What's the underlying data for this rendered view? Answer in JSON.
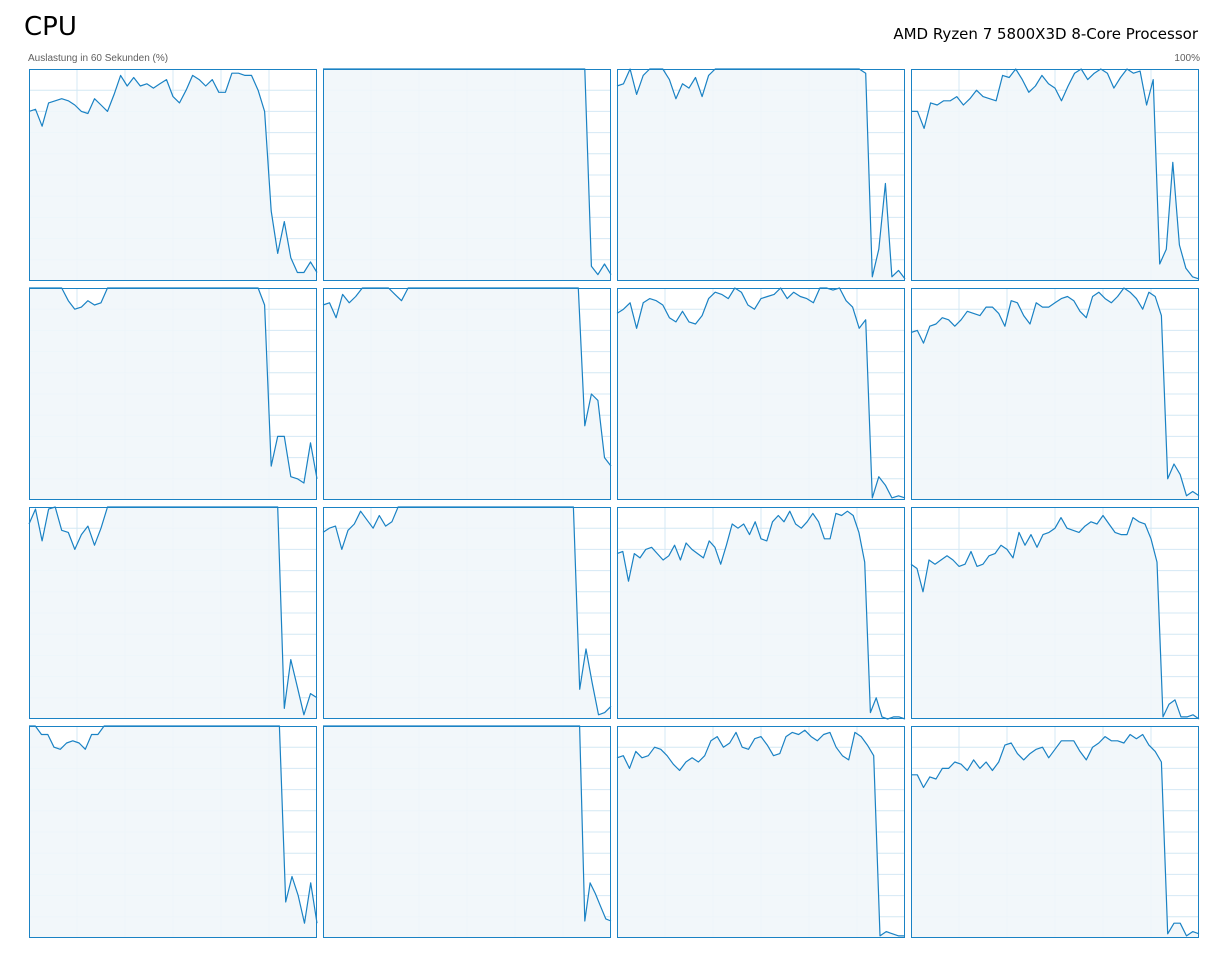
{
  "header": {
    "title": "CPU",
    "processor": "AMD Ryzen 7 5800X3D 8-Core Processor",
    "subtitle": "Auslastung in 60 Sekunden (%)",
    "max_label": "100%"
  },
  "colors": {
    "line": "#1a82c4",
    "fill": "#f1f6fa",
    "grid": "#d4e8f4",
    "border": "#1a82c4"
  },
  "chart_data": {
    "type": "area",
    "layout": "4x4 small multiples, one per logical processor",
    "x_range_seconds": [
      0,
      60
    ],
    "ylim": [
      0,
      100
    ],
    "grid": true,
    "series": [
      {
        "values": [
          80,
          81,
          73,
          84,
          85,
          86,
          85,
          83,
          80,
          79,
          86,
          83,
          80,
          88,
          97,
          92,
          96,
          92,
          93,
          91,
          93,
          95,
          87,
          84,
          90,
          97,
          95,
          92,
          95,
          89,
          89,
          98,
          98,
          97,
          97,
          90,
          80,
          33,
          13,
          28,
          11,
          4,
          4,
          9,
          4
        ]
      },
      {
        "values": [
          100,
          100,
          100,
          100,
          100,
          100,
          100,
          100,
          100,
          100,
          100,
          100,
          100,
          100,
          100,
          100,
          100,
          100,
          100,
          100,
          100,
          100,
          100,
          100,
          100,
          100,
          100,
          100,
          100,
          100,
          100,
          100,
          100,
          100,
          100,
          100,
          100,
          100,
          100,
          100,
          100,
          7,
          3,
          8,
          3
        ]
      },
      {
        "values": [
          92,
          93,
          100,
          88,
          97,
          100,
          100,
          100,
          95,
          86,
          93,
          91,
          96,
          87,
          97,
          100,
          100,
          100,
          100,
          100,
          100,
          100,
          100,
          100,
          100,
          100,
          100,
          100,
          100,
          100,
          100,
          100,
          100,
          100,
          100,
          100,
          100,
          100,
          98,
          2,
          15,
          46,
          2,
          5,
          1
        ]
      },
      {
        "values": [
          80,
          80,
          72,
          84,
          83,
          85,
          85,
          87,
          83,
          86,
          90,
          87,
          86,
          85,
          97,
          96,
          100,
          95,
          89,
          92,
          97,
          93,
          91,
          85,
          92,
          98,
          100,
          95,
          98,
          100,
          98,
          91,
          96,
          100,
          98,
          99,
          83,
          95,
          8,
          15,
          56,
          17,
          6,
          2,
          1
        ]
      },
      {
        "values": [
          100,
          100,
          100,
          100,
          100,
          100,
          94,
          90,
          91,
          94,
          92,
          93,
          100,
          100,
          100,
          100,
          100,
          100,
          100,
          100,
          100,
          100,
          100,
          100,
          100,
          100,
          100,
          100,
          100,
          100,
          100,
          100,
          100,
          100,
          100,
          100,
          92,
          16,
          30,
          30,
          11,
          10,
          8,
          27,
          10
        ]
      },
      {
        "values": [
          92,
          93,
          86,
          97,
          93,
          96,
          100,
          100,
          100,
          100,
          100,
          97,
          94,
          100,
          100,
          100,
          100,
          100,
          100,
          100,
          100,
          100,
          100,
          100,
          100,
          100,
          100,
          100,
          100,
          100,
          100,
          100,
          100,
          100,
          100,
          100,
          100,
          100,
          100,
          100,
          35,
          50,
          47,
          20,
          16
        ]
      },
      {
        "values": [
          88,
          90,
          93,
          81,
          93,
          95,
          94,
          92,
          86,
          84,
          89,
          84,
          83,
          87,
          95,
          98,
          97,
          95,
          100,
          98,
          92,
          90,
          95,
          96,
          97,
          100,
          95,
          98,
          96,
          95,
          93,
          100,
          100,
          99,
          100,
          94,
          91,
          81,
          85,
          1,
          11,
          7,
          1,
          2,
          1
        ]
      },
      {
        "values": [
          79,
          80,
          74,
          82,
          83,
          86,
          85,
          82,
          85,
          89,
          88,
          87,
          91,
          91,
          88,
          82,
          94,
          93,
          87,
          83,
          93,
          91,
          91,
          93,
          95,
          96,
          94,
          89,
          86,
          96,
          98,
          95,
          93,
          96,
          100,
          98,
          95,
          90,
          98,
          96,
          87,
          10,
          17,
          12,
          2,
          4,
          2
        ]
      },
      {
        "values": [
          92,
          99,
          84,
          99,
          100,
          89,
          88,
          80,
          87,
          91,
          82,
          90,
          100,
          100,
          100,
          100,
          100,
          100,
          100,
          100,
          100,
          100,
          100,
          100,
          100,
          100,
          100,
          100,
          100,
          100,
          100,
          100,
          100,
          100,
          100,
          100,
          100,
          100,
          100,
          5,
          28,
          15,
          2,
          12,
          10
        ]
      },
      {
        "values": [
          88,
          90,
          91,
          80,
          89,
          92,
          98,
          94,
          90,
          96,
          91,
          93,
          100,
          100,
          100,
          100,
          100,
          100,
          100,
          100,
          100,
          100,
          100,
          100,
          100,
          100,
          100,
          100,
          100,
          100,
          100,
          100,
          100,
          100,
          100,
          100,
          100,
          100,
          100,
          100,
          100,
          14,
          33,
          17,
          2,
          3,
          6
        ]
      },
      {
        "values": [
          78,
          79,
          65,
          78,
          76,
          80,
          81,
          78,
          75,
          77,
          82,
          75,
          83,
          80,
          78,
          76,
          84,
          81,
          73,
          82,
          92,
          90,
          92,
          87,
          93,
          85,
          84,
          93,
          96,
          93,
          98,
          92,
          90,
          93,
          97,
          93,
          85,
          85,
          97,
          96,
          98,
          96,
          88,
          74,
          3,
          10,
          1,
          0,
          1,
          1,
          0
        ]
      },
      {
        "values": [
          73,
          71,
          60,
          75,
          73,
          75,
          77,
          75,
          72,
          73,
          79,
          72,
          73,
          77,
          78,
          82,
          80,
          76,
          88,
          82,
          87,
          81,
          87,
          88,
          90,
          95,
          90,
          89,
          88,
          91,
          93,
          92,
          96,
          92,
          88,
          87,
          87,
          95,
          93,
          92,
          85,
          74,
          1,
          7,
          9,
          1,
          1,
          2,
          0
        ]
      },
      {
        "values": [
          100,
          100,
          96,
          96,
          90,
          89,
          92,
          93,
          92,
          89,
          96,
          96,
          100,
          100,
          100,
          100,
          100,
          100,
          100,
          100,
          100,
          100,
          100,
          100,
          100,
          100,
          100,
          100,
          100,
          100,
          100,
          100,
          100,
          100,
          100,
          100,
          100,
          100,
          100,
          100,
          100,
          17,
          29,
          20,
          7,
          26,
          7
        ]
      },
      {
        "values": [
          100,
          100,
          100,
          100,
          100,
          100,
          100,
          100,
          100,
          100,
          100,
          100,
          100,
          100,
          100,
          100,
          100,
          100,
          100,
          100,
          100,
          100,
          100,
          100,
          100,
          100,
          100,
          100,
          100,
          100,
          100,
          100,
          100,
          100,
          100,
          100,
          100,
          100,
          100,
          100,
          100,
          100,
          100,
          100,
          100,
          100,
          100,
          100,
          100,
          100,
          8,
          26,
          21,
          15,
          9,
          8
        ]
      },
      {
        "values": [
          85,
          86,
          80,
          88,
          85,
          86,
          90,
          89,
          86,
          82,
          79,
          83,
          85,
          83,
          86,
          93,
          95,
          90,
          92,
          97,
          90,
          89,
          94,
          95,
          91,
          86,
          87,
          95,
          97,
          96,
          98,
          95,
          93,
          96,
          97,
          90,
          86,
          84,
          97,
          95,
          91,
          86,
          1,
          3,
          2,
          1,
          1
        ]
      },
      {
        "values": [
          77,
          77,
          71,
          76,
          75,
          80,
          80,
          83,
          82,
          79,
          84,
          80,
          83,
          79,
          83,
          91,
          92,
          87,
          84,
          87,
          89,
          90,
          85,
          89,
          93,
          93,
          93,
          88,
          84,
          90,
          92,
          95,
          93,
          93,
          92,
          96,
          94,
          96,
          91,
          88,
          83,
          2,
          7,
          7,
          1,
          3,
          2
        ]
      }
    ]
  }
}
